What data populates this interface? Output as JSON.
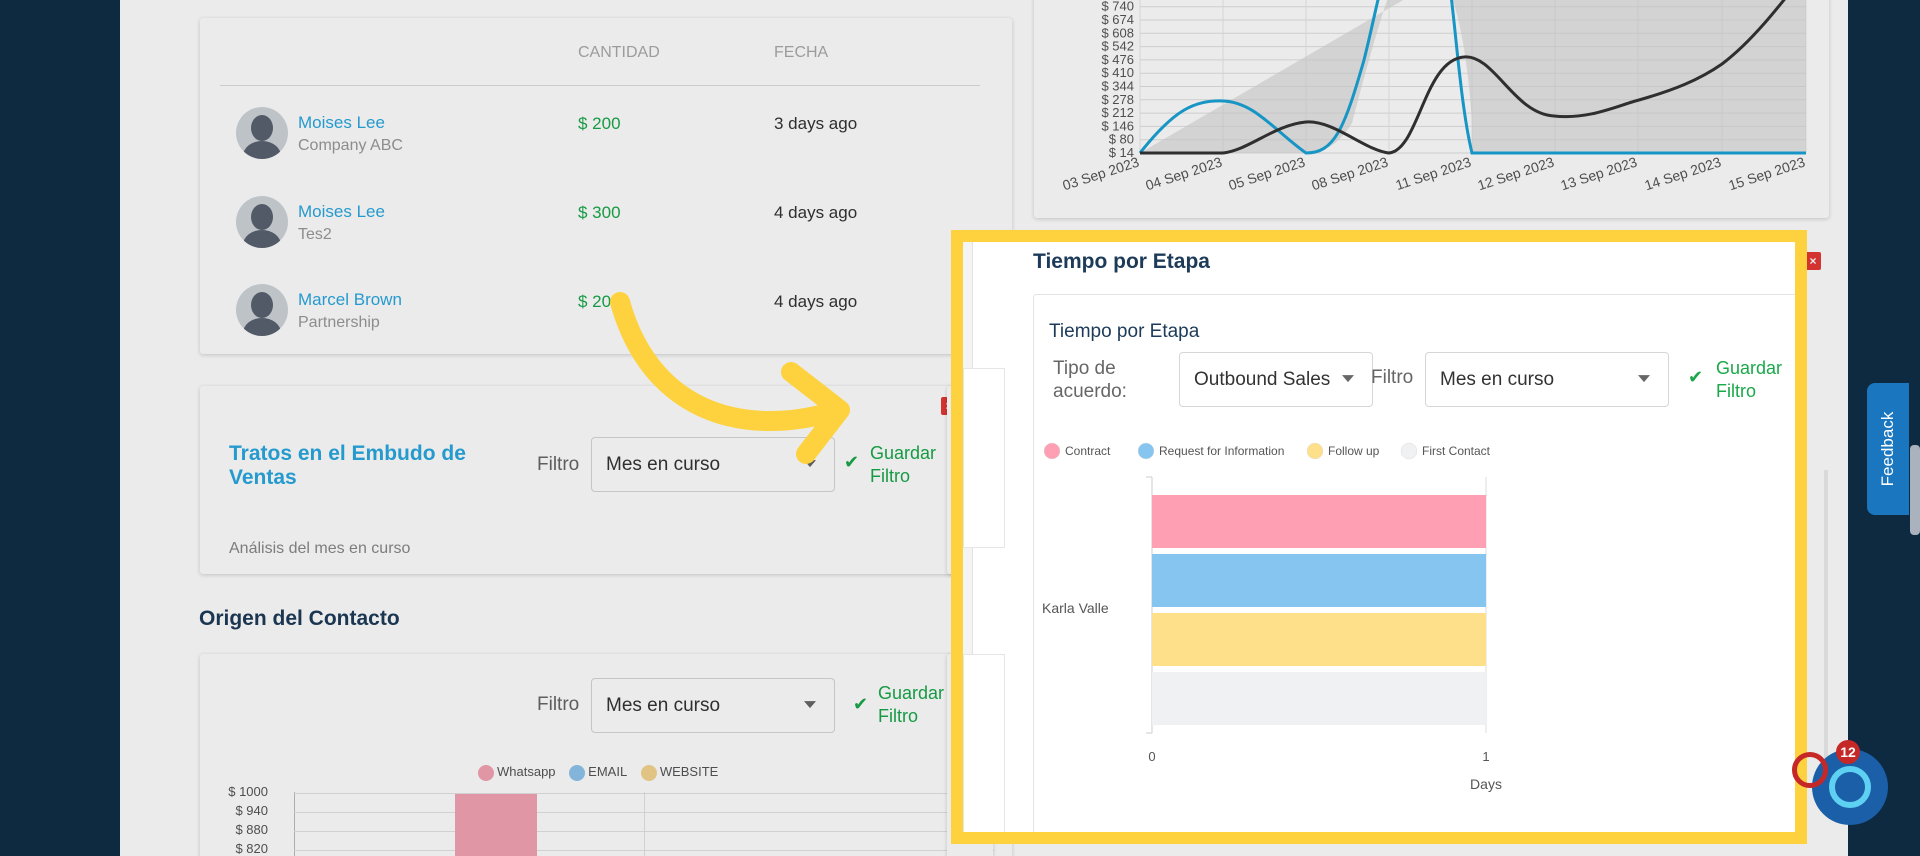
{
  "deals_table": {
    "columns": [
      "CANTIDAD",
      "FECHA"
    ],
    "rows": [
      {
        "name": "Moises Lee",
        "company": "Company ABC",
        "amount": "$ 200",
        "date": "3 days ago"
      },
      {
        "name": "Moises Lee",
        "company": "Tes2",
        "amount": "$ 300",
        "date": "4 days ago"
      },
      {
        "name": "Marcel Brown",
        "company": "Partnership",
        "amount": "$ 200",
        "date": "4 days ago"
      }
    ]
  },
  "funnel": {
    "title": "Tratos en el Embudo de Ventas",
    "filter_label": "Filtro",
    "filter_value": "Mes en curso",
    "save_label": "Guardar Filtro",
    "analysis": "Análisis del mes en curso"
  },
  "origin": {
    "title": "Origen del Contacto",
    "filter_label": "Filtro",
    "filter_value": "Mes en curso",
    "save_label": "Guardar Filtro",
    "legend": [
      "Whatsapp",
      "EMAIL",
      "WEBSITE"
    ],
    "legend_colors": [
      "#f4a3b3",
      "#8ec5ec",
      "#f5d590"
    ],
    "yticks": [
      "$ 1000",
      "$ 940",
      "$ 880",
      "$ 820"
    ]
  },
  "top_chart": {
    "yticks": [
      "$ 740",
      "$ 674",
      "$ 608",
      "$ 542",
      "$ 476",
      "$ 410",
      "$ 344",
      "$ 278",
      "$ 212",
      "$ 146",
      "$ 80",
      "$ 14"
    ],
    "xticks": [
      "03 Sep 2023",
      "04 Sep 2023",
      "05 Sep 2023",
      "08 Sep 2023",
      "11 Sep 2023",
      "12 Sep 2023",
      "13 Sep 2023",
      "14 Sep 2023",
      "15 Sep 2023"
    ]
  },
  "stage_time": {
    "heading": "Tiempo por Etapa",
    "card_title": "Tiempo por Etapa",
    "deal_type_label": "Tipo de acuerdo:",
    "deal_type_value": "Outbound Sales",
    "filter_label": "Filtro",
    "filter_value": "Mes en curso",
    "save_label": "Guardar Filtro"
  },
  "chart_data": {
    "type": "bar",
    "orientation": "horizontal",
    "categories": [
      "Karla Valle"
    ],
    "series": [
      {
        "name": "Contract",
        "values": [
          1
        ],
        "color": "#ff9fb3"
      },
      {
        "name": "Request for Information",
        "values": [
          1
        ],
        "color": "#86c5f0"
      },
      {
        "name": "Follow up",
        "values": [
          1
        ],
        "color": "#ffe08a"
      },
      {
        "name": "First Contact",
        "values": [
          1
        ],
        "color": "#f0f1f3"
      }
    ],
    "xlabel": "Days",
    "xlim": [
      0,
      1
    ],
    "xticks": [
      "0",
      "1"
    ],
    "legend_position": "top-left"
  },
  "widgets": {
    "feedback_label": "Feedback",
    "notification_count": "12"
  }
}
